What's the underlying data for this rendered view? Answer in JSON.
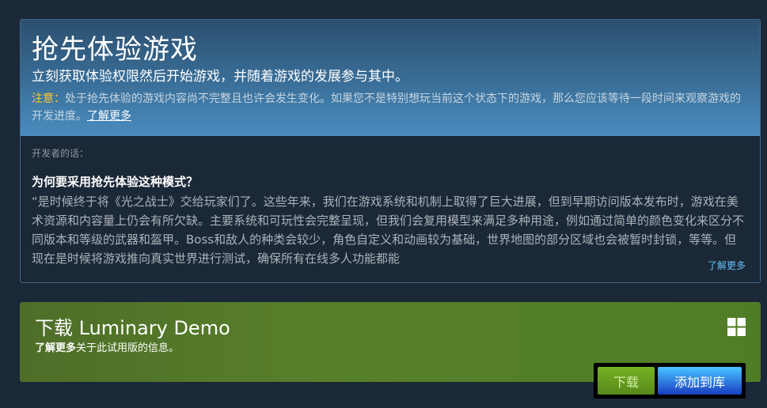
{
  "early_access": {
    "title": "抢先体验游戏",
    "subtitle": "立刻获取体验权限然后开始游戏，并随着游戏的发展参与其中。",
    "note_label": "注意：",
    "note_text": "处于抢先体验的游戏内容尚不完整且也许会发生变化。如果您不是特别想玩当前这个状态下的游戏，那么您应该等待一段时间来观察游戏的开发进度。",
    "note_link": "了解更多",
    "developer_label": "开发者的话：",
    "question": "为何要采用抢先体验这种模式？",
    "answer": "“是时候终于将《光之战士》交给玩家们了。这些年来，我们在游戏系统和机制上取得了巨大进展，但到早期访问版本发布时，游戏在美术资源和内容量上仍会有所欠缺。主要系统和可玩性会完整呈现，但我们会复用模型来满足多种用途，例如通过简单的颜色变化来区分不同版本和等级的武器和盔甲。Boss和敌人的种类会较少，角色自定义和动画较为基础，世界地图的部分区域也会被暂时封锁，等等。但现在是时候将游戏推向真实世界进行测试，确保所有在线多人功能都能",
    "read_more": "了解更多"
  },
  "demo": {
    "title": "下载 Luminary Demo",
    "info_link": "了解更多",
    "info_text": "关于此试用版的信息。",
    "platform_icon": "windows-icon",
    "download_label": "下载",
    "wishlist_label": "添加到库"
  },
  "colors": {
    "background": "#1b2838",
    "note_label": "#ffc82c",
    "link_blue": "#66c0f4",
    "demo_green": "#577f2a",
    "download_green": "#75b022",
    "wishlist_blue": "#47bfff"
  }
}
